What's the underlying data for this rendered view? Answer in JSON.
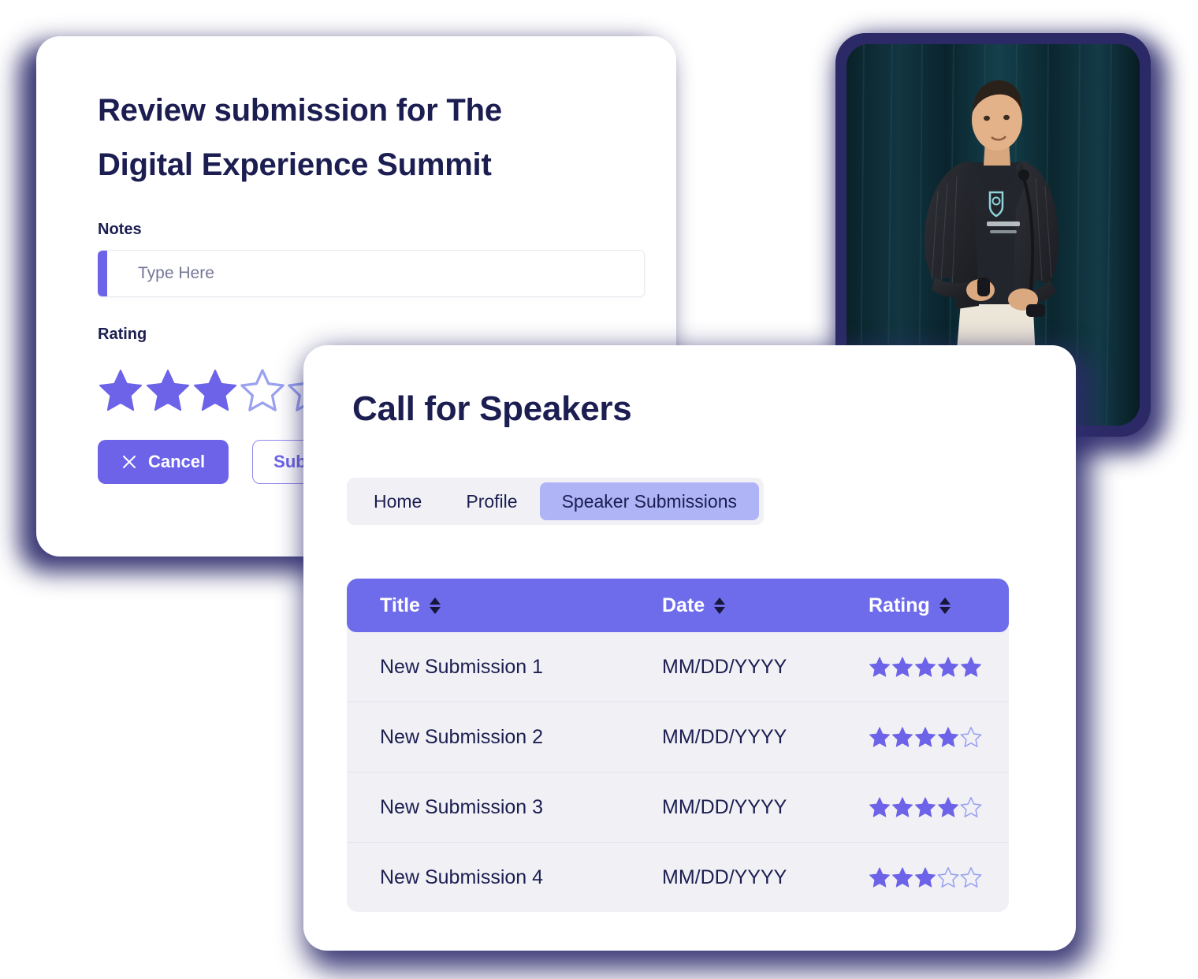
{
  "review_card": {
    "title": "Review submission for The Digital Experience Summit",
    "notes": {
      "label": "Notes",
      "placeholder": "Type Here",
      "value": ""
    },
    "rating": {
      "label": "Rating",
      "value": 3,
      "max": 5
    },
    "buttons": {
      "cancel": "Cancel",
      "submit": "Submit"
    }
  },
  "speakers_card": {
    "title": "Call for Speakers",
    "nav": [
      {
        "label": "Home",
        "active": false
      },
      {
        "label": "Profile",
        "active": false
      },
      {
        "label": "Speaker Submissions",
        "active": true
      }
    ],
    "table": {
      "columns": [
        {
          "label": "Title",
          "sortable": true
        },
        {
          "label": "Date",
          "sortable": true
        },
        {
          "label": "Rating",
          "sortable": true
        }
      ],
      "rows": [
        {
          "title": "New Submission 1",
          "date": "MM/DD/YYYY",
          "rating": 5
        },
        {
          "title": "New Submission 2",
          "date": "MM/DD/YYYY",
          "rating": 4
        },
        {
          "title": "New Submission 3",
          "date": "MM/DD/YYYY",
          "rating": 4
        },
        {
          "title": "New Submission 4",
          "date": "MM/DD/YYYY",
          "rating": 3
        }
      ],
      "rating_max": 5
    }
  },
  "photo_card": {
    "alt": "Speaker presenting on stage in front of a dark curtain"
  },
  "colors": {
    "accent_purple": "#6C63E8",
    "table_header_purple": "#6E6CEA",
    "nav_active_lavender": "#AEB4F5",
    "navy_text": "#1C1E52",
    "card_shadow_navy": "#2F2D6E",
    "panel_gray": "#F1F1F5"
  }
}
